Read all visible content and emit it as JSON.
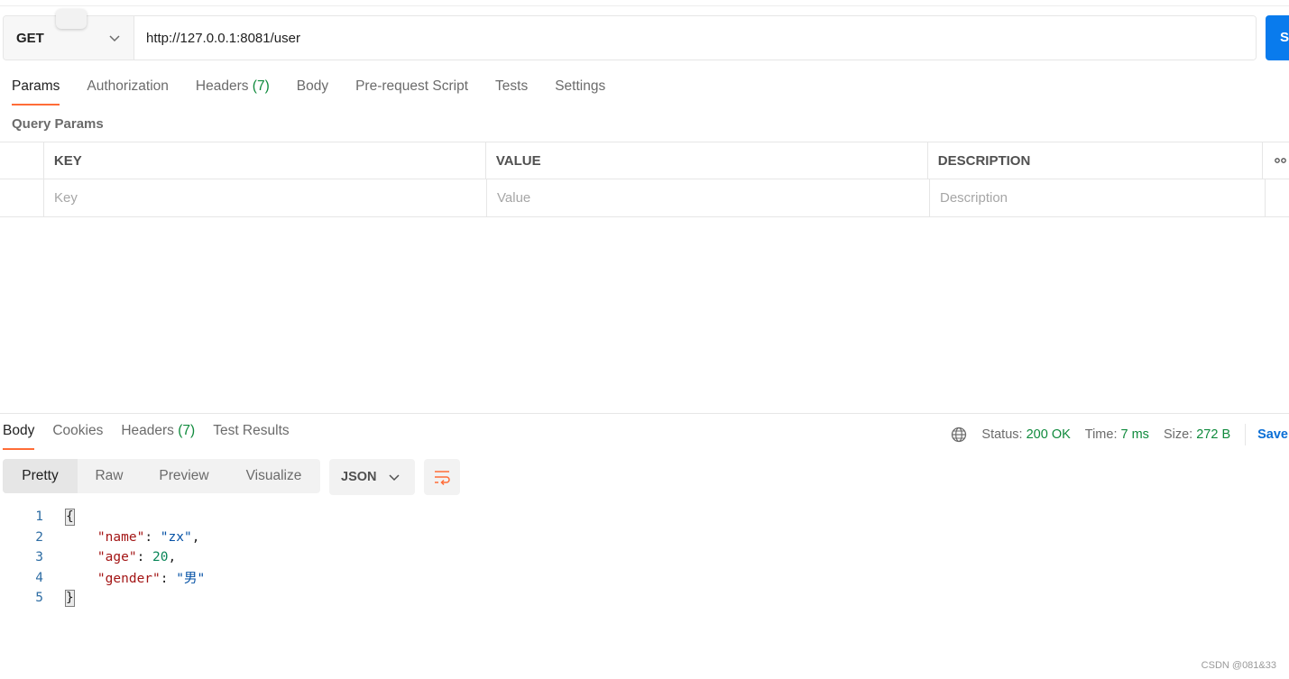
{
  "request": {
    "method": "GET",
    "url": "http://127.0.0.1:8081/user",
    "send_label": "S"
  },
  "request_tabs": [
    {
      "label": "Params",
      "active": true
    },
    {
      "label": "Authorization"
    },
    {
      "label": "Headers",
      "count": "(7)"
    },
    {
      "label": "Body"
    },
    {
      "label": "Pre-request Script"
    },
    {
      "label": "Tests"
    },
    {
      "label": "Settings"
    }
  ],
  "query_params": {
    "title": "Query Params",
    "headers": [
      "KEY",
      "VALUE",
      "DESCRIPTION"
    ],
    "more_icon": "more-horizontal-icon",
    "placeholders": {
      "key": "Key",
      "value": "Value",
      "description": "Description"
    }
  },
  "response_tabs": [
    {
      "label": "Body",
      "active": true
    },
    {
      "label": "Cookies"
    },
    {
      "label": "Headers",
      "count": "(7)"
    },
    {
      "label": "Test Results"
    }
  ],
  "status": {
    "globe_icon": "globe-icon",
    "status_label": "Status:",
    "status_value": "200 OK",
    "time_label": "Time:",
    "time_value": "7 ms",
    "size_label": "Size:",
    "size_value": "272 B",
    "save_label": "Save"
  },
  "view_modes": [
    "Pretty",
    "Raw",
    "Preview",
    "Visualize"
  ],
  "active_view": "Pretty",
  "format": "JSON",
  "wrap_icon": "wrap-lines-icon",
  "response_body": {
    "line_numbers": [
      "1",
      "2",
      "3",
      "4",
      "5"
    ],
    "open_brace": "{",
    "close_brace": "}",
    "fields": [
      {
        "key": "\"name\"",
        "value": "\"zx\"",
        "type": "string",
        "trail": ","
      },
      {
        "key": "\"age\"",
        "value": "20",
        "type": "number",
        "trail": ","
      },
      {
        "key": "\"gender\"",
        "value": "\"男\"",
        "type": "string",
        "trail": ""
      }
    ]
  },
  "watermark": "CSDN @081&33",
  "colors": {
    "accent_tab": "#ff6c37",
    "send_button": "#097bed",
    "success_green": "#0f8a3c",
    "save_blue": "#0b6fd6",
    "json_key": "#a31515",
    "json_string": "#0451a5",
    "json_number": "#098658"
  }
}
